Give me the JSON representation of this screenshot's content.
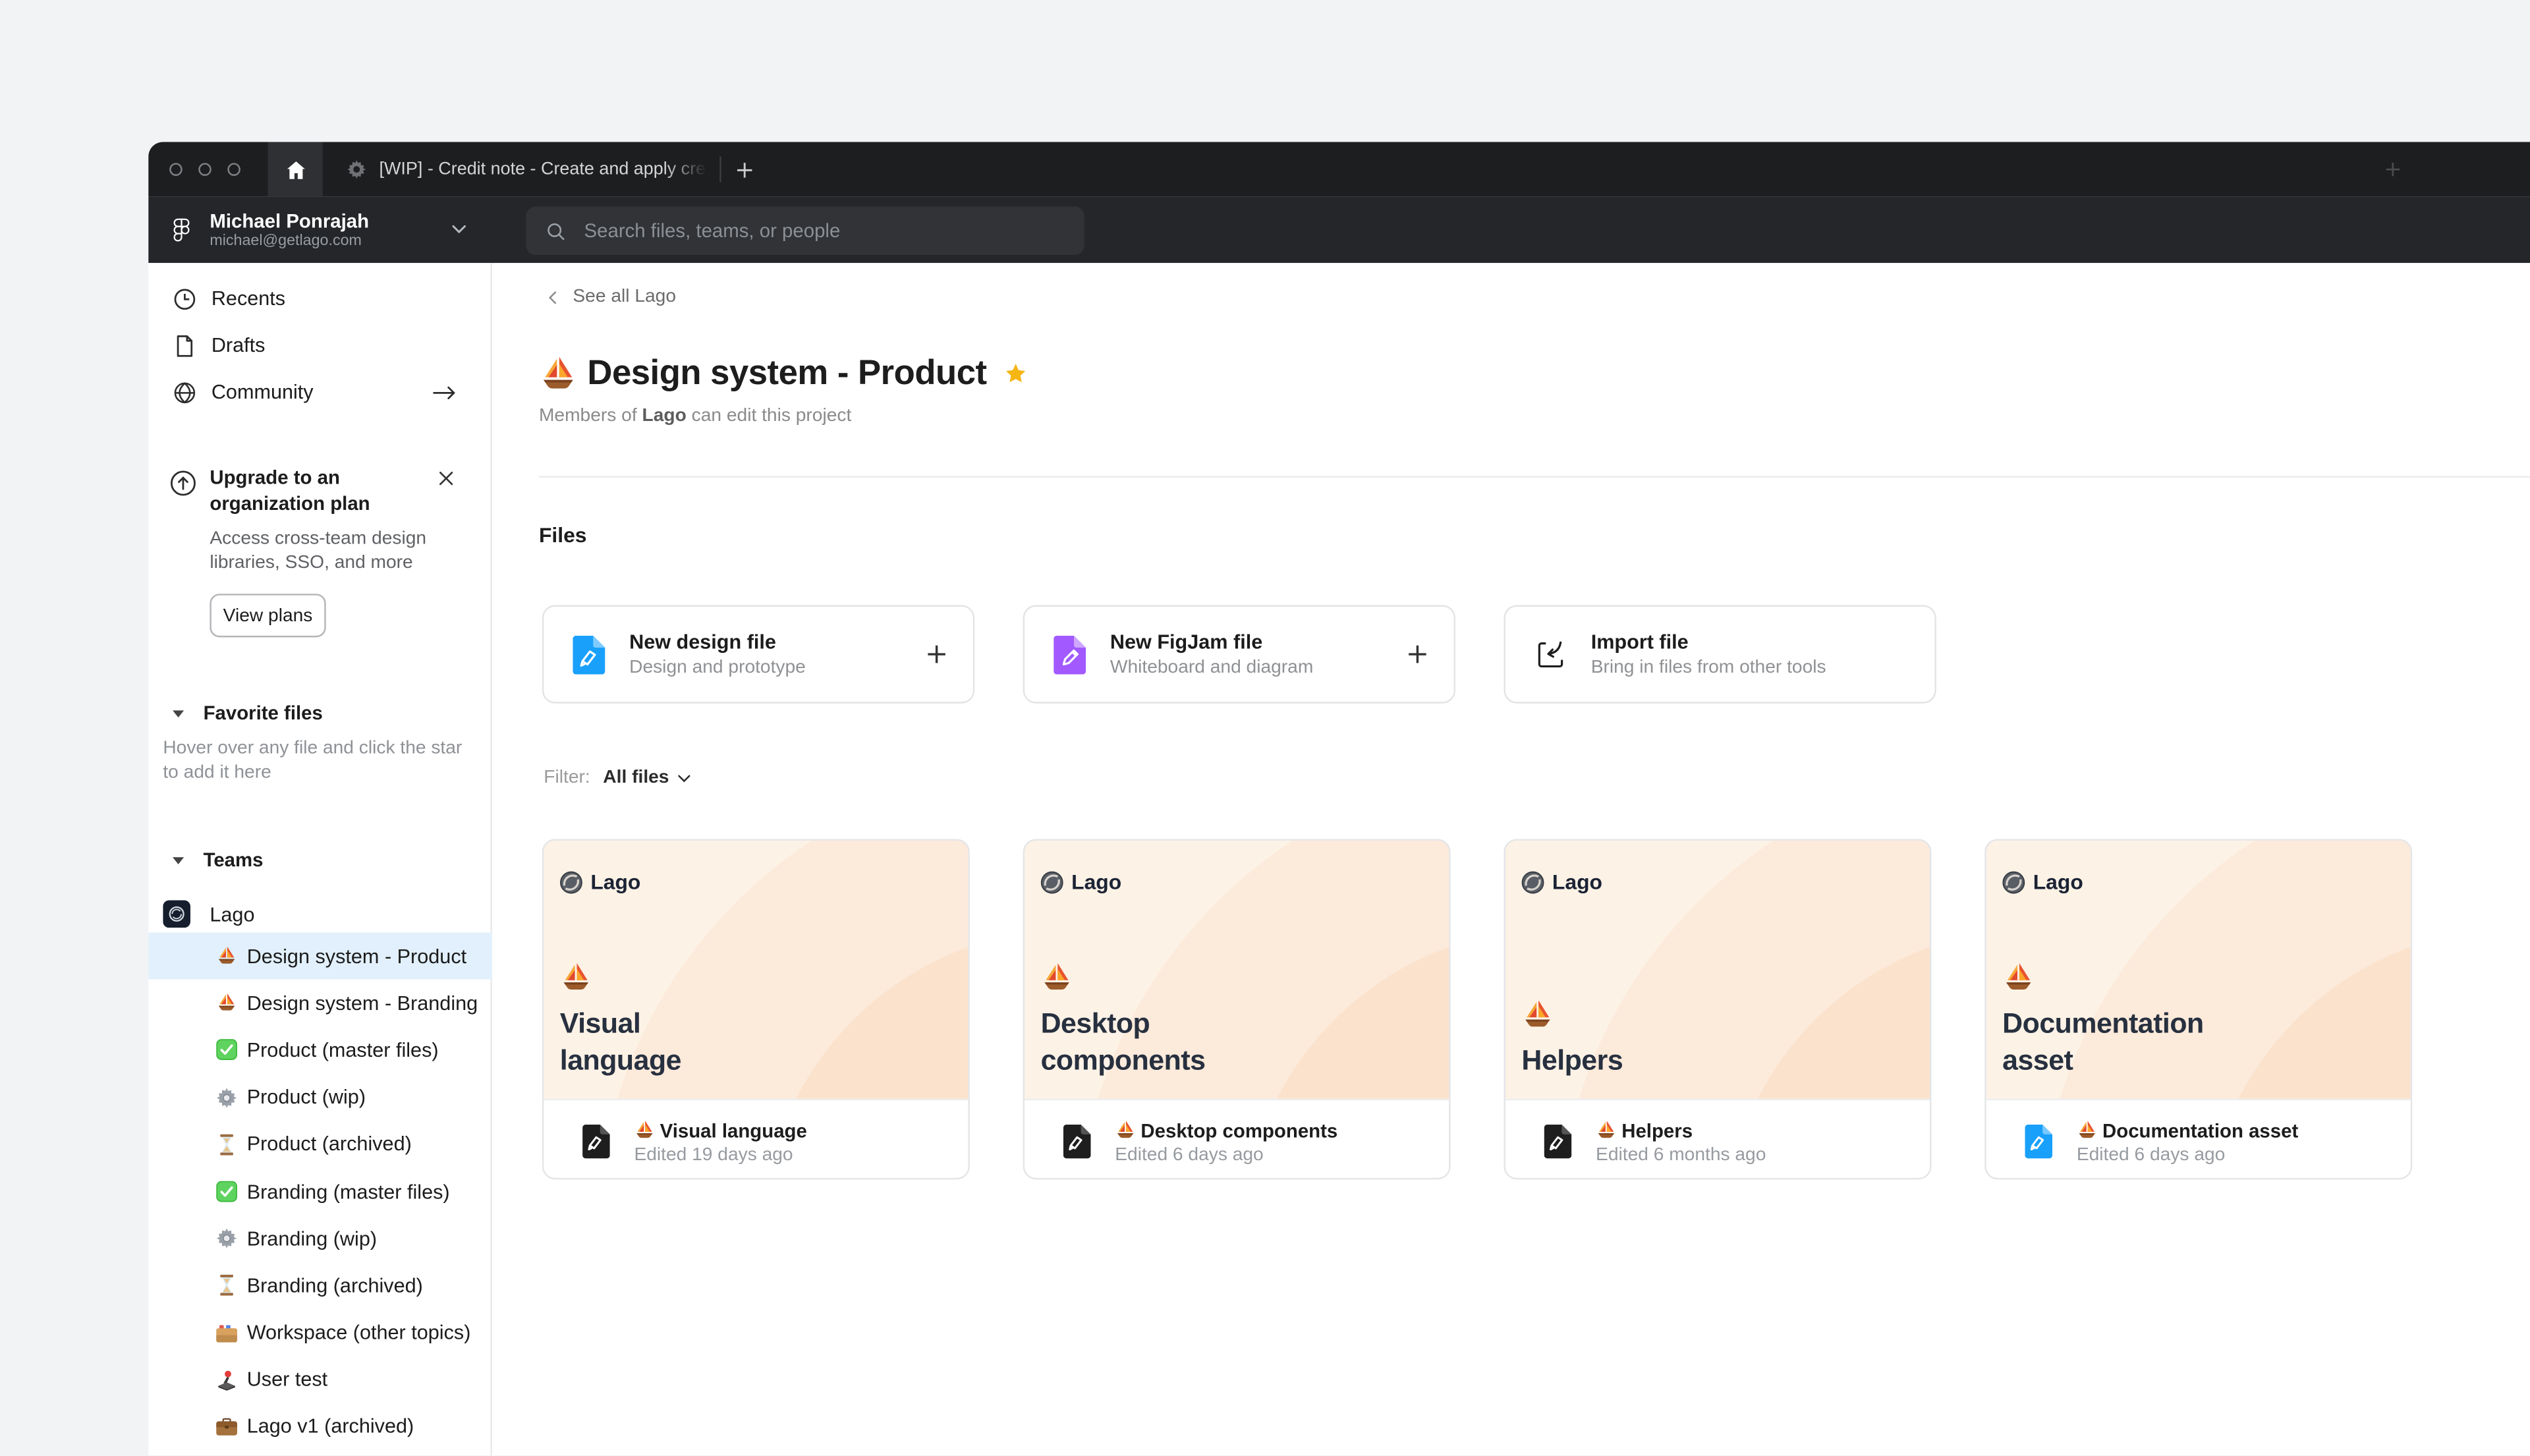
{
  "tabbar": {
    "doc_tab": {
      "icon": "gear-icon",
      "title": "[WIP] - Credit note - Create and apply cre"
    }
  },
  "header": {
    "logo_icon": "figma-logo-icon",
    "user": {
      "name": "Michael Ponrajah",
      "email": "michael@getlago.com",
      "menu_icon": "chevron-down-icon"
    },
    "search": {
      "icon": "search-icon",
      "placeholder": "Search files, teams, or people"
    }
  },
  "sidebar": {
    "nav": [
      {
        "icon": "clock-icon",
        "label": "Recents"
      },
      {
        "icon": "file-icon",
        "label": "Drafts"
      },
      {
        "icon": "globe-icon",
        "label": "Community",
        "trailing_icon": "arrow-right-icon"
      }
    ],
    "upgrade": {
      "icon": "upload-circle-icon",
      "title_lines": [
        "Upgrade to an",
        "organization plan"
      ],
      "description": "Access cross-team design libraries, SSO, and more",
      "button_label": "View plans",
      "close_icon": "close-icon"
    },
    "favorites": {
      "caret_icon": "caret-down-icon",
      "title": "Favorite files",
      "hint": "Hover over any file and click the star to add it here"
    },
    "teams": {
      "caret_icon": "caret-down-icon",
      "title": "Teams",
      "team": {
        "avatar_icon": "lago-avatar",
        "name": "Lago"
      },
      "projects": [
        {
          "icon": "sailboat-emoji",
          "label": "Design system - Product",
          "selected": true
        },
        {
          "icon": "sailboat-emoji",
          "label": "Design system - Branding",
          "selected": false
        },
        {
          "icon": "check-emoji",
          "label": "Product (master files)",
          "selected": false
        },
        {
          "icon": "gear-emoji",
          "label": "Product (wip)",
          "selected": false
        },
        {
          "icon": "hourglass-emoji",
          "label": "Product (archived)",
          "selected": false
        },
        {
          "icon": "check-emoji",
          "label": "Branding (master files)",
          "selected": false
        },
        {
          "icon": "gear-emoji",
          "label": "Branding (wip)",
          "selected": false
        },
        {
          "icon": "hourglass-emoji",
          "label": "Branding (archived)",
          "selected": false
        },
        {
          "icon": "folder-emoji",
          "label": "Workspace (other topics)",
          "selected": false
        },
        {
          "icon": "joystick-emoji",
          "label": "User test",
          "selected": false
        },
        {
          "icon": "briefcase-emoji",
          "label": "Lago v1 (archived)",
          "selected": false
        }
      ]
    }
  },
  "main": {
    "breadcrumb": {
      "icon": "chevron-left-icon",
      "label": "See all Lago"
    },
    "title": {
      "icon": "sailboat-emoji",
      "text": "Design system - Product",
      "star_icon": "star-icon"
    },
    "subtitle": {
      "prefix": "Members of ",
      "team": "Lago",
      "suffix": " can edit this project"
    },
    "files_heading": "Files",
    "new_file_cards": [
      {
        "icon": "design-file-icon",
        "title": "New design file",
        "subtitle": "Design and prototype",
        "action_icon": "plus-icon"
      },
      {
        "icon": "figjam-file-icon",
        "title": "New FigJam file",
        "subtitle": "Whiteboard and diagram",
        "action_icon": "plus-icon"
      },
      {
        "icon": "import-icon",
        "title": "Import file",
        "subtitle": "Bring in files from other tools"
      }
    ],
    "filter": {
      "label": "Filter:",
      "value": "All files",
      "caret_icon": "chevron-down-icon"
    },
    "file_cards": [
      {
        "brand": "Lago",
        "brand_icon": "lago-mark",
        "emoji": "sailboat-emoji",
        "title_lines": [
          "Visual",
          "language"
        ],
        "doc_icon": "design-doc-dark-icon",
        "name": "Visual language",
        "edited": "Edited 19 days ago"
      },
      {
        "brand": "Lago",
        "brand_icon": "lago-mark",
        "emoji": "sailboat-emoji",
        "title_lines": [
          "Desktop",
          "components"
        ],
        "doc_icon": "design-doc-dark-icon",
        "name": "Desktop components",
        "edited": "Edited 6 days ago"
      },
      {
        "brand": "Lago",
        "brand_icon": "lago-mark",
        "emoji": "sailboat-emoji",
        "title_lines": [
          "Helpers"
        ],
        "doc_icon": "design-doc-dark-icon",
        "name": "Helpers",
        "edited": "Edited 6 months ago"
      },
      {
        "brand": "Lago",
        "brand_icon": "lago-mark",
        "emoji": "sailboat-emoji",
        "title_lines": [
          "Documentation",
          "asset"
        ],
        "doc_icon": "design-doc-blue-icon",
        "name": "Documentation asset",
        "edited": "Edited 6 days ago"
      }
    ]
  },
  "colors": {
    "design_blue": "#18A0FB",
    "figjam_purple": "#A259FF",
    "selected_row": "#E1F0FC",
    "thumbnail_peach": "#FBE3CE",
    "star_gold": "#F5B513",
    "title_navy": "#27303F"
  }
}
